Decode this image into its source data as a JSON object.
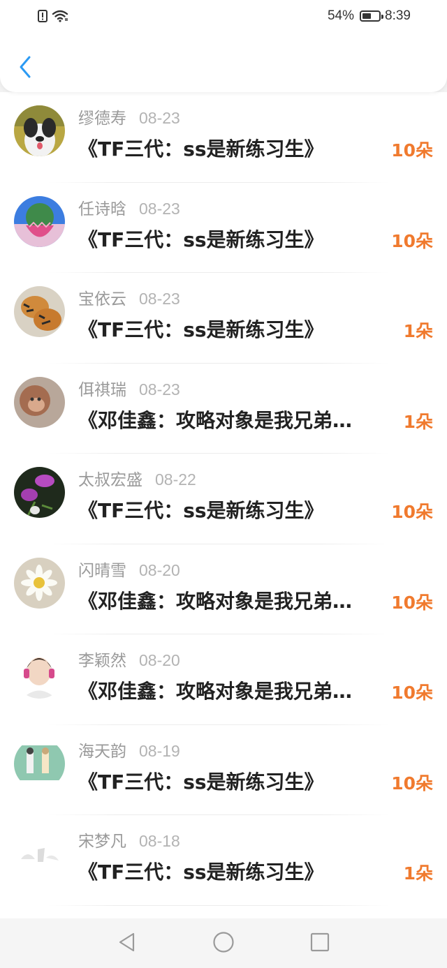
{
  "status_bar": {
    "battery_percent": "54%",
    "battery_level": 0.54,
    "time": "8:39",
    "icons": [
      "alert-icon",
      "wifi-icon",
      "battery-icon"
    ]
  },
  "header": {
    "back_icon": "chevron-left-icon"
  },
  "colors": {
    "accent_orange": "#f07a2e",
    "back_blue": "#2b9af3",
    "name_gray": "#9a9a9a",
    "title_dark": "#222222"
  },
  "items": [
    {
      "name": "缪德寿",
      "date": "08-23",
      "title": "《TF三代：ss是新练习生》",
      "count": "10朵",
      "avatar": "dog-avatar"
    },
    {
      "name": "任诗晗",
      "date": "08-23",
      "title": "《TF三代：ss是新练习生》",
      "count": "10朵",
      "avatar": "cactus-avatar"
    },
    {
      "name": "宝依云",
      "date": "08-23",
      "title": "《TF三代：ss是新练习生》",
      "count": "1朵",
      "avatar": "tigers-avatar"
    },
    {
      "name": "佴祺瑞",
      "date": "08-23",
      "title": "《邓佳鑫：攻略对象是我兄弟…",
      "count": "1朵",
      "avatar": "monkey-avatar"
    },
    {
      "name": "太叔宏盛",
      "date": "08-22",
      "title": "《TF三代：ss是新练习生》",
      "count": "10朵",
      "avatar": "morning-glory-avatar"
    },
    {
      "name": "闪晴雪",
      "date": "08-20",
      "title": "《邓佳鑫：攻略对象是我兄弟…",
      "count": "10朵",
      "avatar": "daisy-avatar"
    },
    {
      "name": "李颖然",
      "date": "08-20",
      "title": "《邓佳鑫：攻略对象是我兄弟…",
      "count": "10朵",
      "avatar": "boy-headphones-avatar"
    },
    {
      "name": "海天韵",
      "date": "08-19",
      "title": "《TF三代：ss是新练习生》",
      "count": "10朵",
      "avatar": "two-girls-avatar"
    },
    {
      "name": "宋梦凡",
      "date": "08-18",
      "title": "《TF三代：ss是新练习生》",
      "count": "1朵",
      "avatar": "faded-sketch-avatar"
    }
  ],
  "nav_bar": {
    "buttons": [
      "back-triangle-icon",
      "home-circle-icon",
      "recents-square-icon"
    ]
  }
}
